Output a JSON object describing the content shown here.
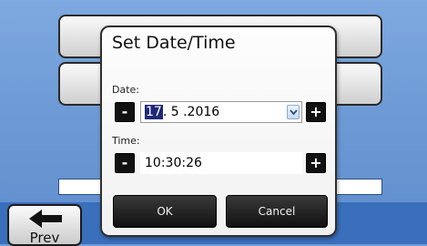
{
  "background": {
    "prev_label": "Prev"
  },
  "dialog": {
    "title": "Set Date/Time",
    "date_label": "Date:",
    "date": {
      "day": "17",
      "rest": ". 5 .2016"
    },
    "time_label": "Time:",
    "time_value": "10:30:26",
    "minus_label": "-",
    "plus_label": "+",
    "ok_label": "OK",
    "cancel_label": "Cancel"
  },
  "colors": {
    "background_blue": "#6f9cd6",
    "selection": "#1f2a78",
    "button_dark": "#111111"
  }
}
